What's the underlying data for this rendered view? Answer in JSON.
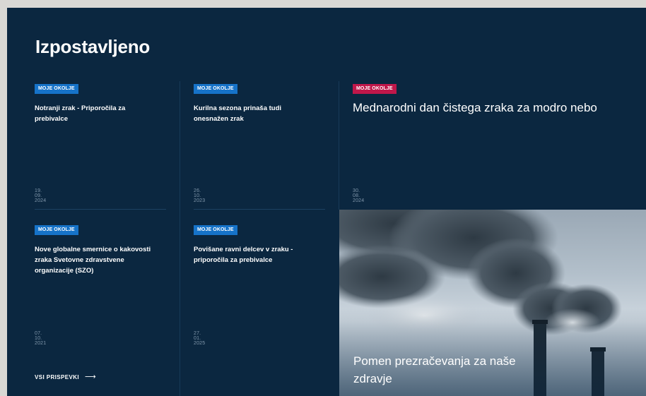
{
  "section": {
    "title": "Izpostavljeno"
  },
  "articles": [
    {
      "category": "MOJE OKOLJE",
      "title": "Notranji zrak - Priporočila za prebivalce",
      "date": "19. 09. 2024"
    },
    {
      "category": "MOJE OKOLJE",
      "title": "Kurilna sezona prinaša tudi onesnažen zrak",
      "date": "26. 10. 2023"
    },
    {
      "category": "MOJE OKOLJE",
      "title": "Mednarodni dan čistega zraka za modro nebo",
      "date": "30. 08. 2024",
      "badge_color": "#c0174a"
    },
    {
      "category": "MOJE OKOLJE",
      "title": "Nove globalne smernice o kakovosti zraka Svetovne zdravstvene organizacije (SZO)",
      "date": "07. 10. 2021"
    },
    {
      "category": "MOJE OKOLJE",
      "title": "Povišane ravni delcev v zraku - priporočila za prebivalce",
      "date": "27. 01. 2025"
    }
  ],
  "featured_image": {
    "title": "Pomen prezračevanja za naše zdravje",
    "icon": "smokestack-photo"
  },
  "all_posts": {
    "label": "VSI PRISPEVKI",
    "arrow": "⟶"
  },
  "colors": {
    "background": "#0b2740",
    "badge_blue": "#1673c9",
    "badge_pink": "#c0174a",
    "date_text": "#8197ab"
  }
}
